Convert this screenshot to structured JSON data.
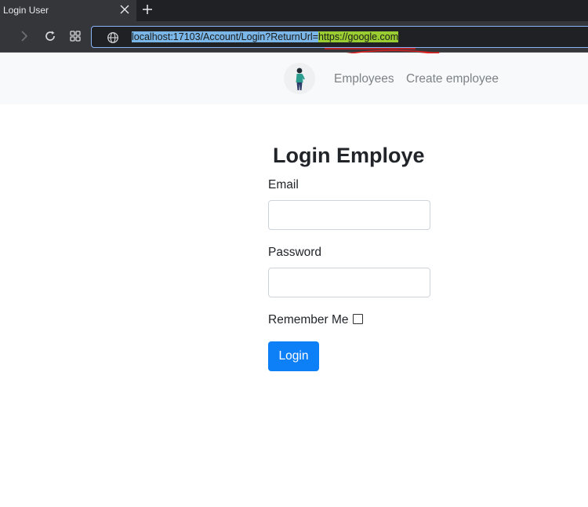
{
  "browser": {
    "tab_title": "Login User",
    "url_highlight_1": "localhost:17103/Account/Login?ReturnUrl=",
    "url_highlight_2": "https://google.com"
  },
  "navbar": {
    "links": [
      "Employees",
      "Create employee"
    ]
  },
  "form": {
    "title": "Login Employe",
    "email_label": "Email",
    "email_value": "",
    "password_label": "Password",
    "password_value": "",
    "remember_label": "Remember Me",
    "remember_checked": false,
    "submit_label": "Login"
  },
  "colors": {
    "accent": "#0d7ff7",
    "url_highlight_1": "#7ab7e8",
    "url_highlight_2": "#9acd32",
    "annotation": "#e01c1c"
  },
  "icons": [
    "close-icon",
    "plus-icon",
    "forward-icon",
    "reload-icon",
    "apps-icon",
    "globe-icon"
  ]
}
